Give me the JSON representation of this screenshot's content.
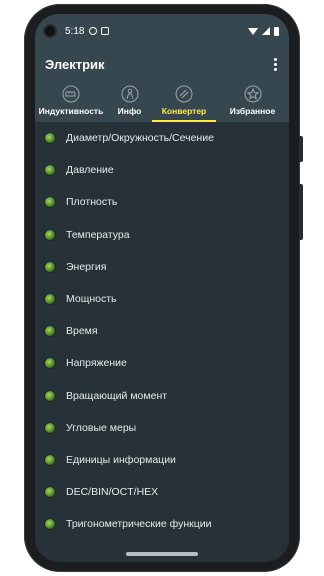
{
  "status_bar": {
    "time": "5:18"
  },
  "app_bar": {
    "title": "Электрик"
  },
  "tabs": [
    {
      "label": "Индуктивность",
      "icon": "coil-icon",
      "active": false
    },
    {
      "label": "Инфо",
      "icon": "person-info-icon",
      "active": false
    },
    {
      "label": "Конвертер",
      "icon": "converter-icon",
      "active": true
    },
    {
      "label": "Избранное",
      "icon": "star-icon",
      "active": false
    }
  ],
  "list": {
    "items": [
      {
        "label": "Диаметр/Окружность/Сечение"
      },
      {
        "label": "Давление"
      },
      {
        "label": "Плотность"
      },
      {
        "label": "Температура"
      },
      {
        "label": "Энергия"
      },
      {
        "label": "Мощность"
      },
      {
        "label": "Время"
      },
      {
        "label": "Напряжение"
      },
      {
        "label": "Вращающий момент"
      },
      {
        "label": "Угловые меры"
      },
      {
        "label": "Единицы информации"
      },
      {
        "label": "DEC/BIN/OCT/HEX"
      },
      {
        "label": "Тригонометрические функции"
      }
    ]
  },
  "colors": {
    "toolbar": "#37474f",
    "background": "#263238",
    "accent": "#ffeb3b",
    "bullet": "#5e9b2e"
  }
}
